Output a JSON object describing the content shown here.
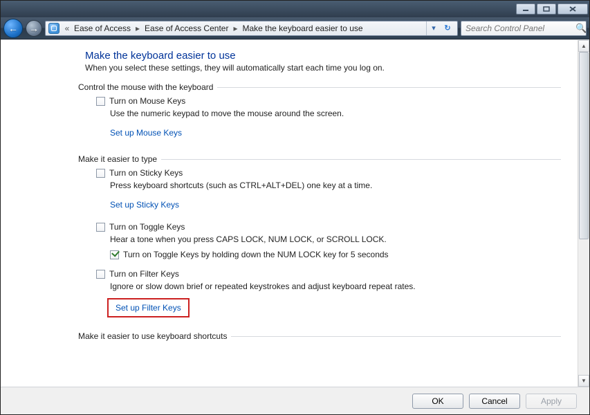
{
  "titlebar": {
    "min_tip": "Minimize",
    "max_tip": "Maximize",
    "close_tip": "Close"
  },
  "nav": {
    "back_tip": "Back",
    "fwd_tip": "Forward"
  },
  "breadcrumb": {
    "prefix": "«",
    "seg1": "Ease of Access",
    "seg2": "Ease of Access Center",
    "seg3": "Make the keyboard easier to use"
  },
  "search": {
    "placeholder": "Search Control Panel"
  },
  "page": {
    "title": "Make the keyboard easier to use",
    "subtitle": "When you select these settings, they will automatically start each time you log on."
  },
  "grp_mouse": {
    "head": "Control the mouse with the keyboard",
    "chk_label": "Turn on Mouse Keys",
    "desc": "Use the numeric keypad to move the mouse around the screen.",
    "link": "Set up Mouse Keys"
  },
  "grp_type": {
    "head": "Make it easier to type",
    "sticky_chk": "Turn on Sticky Keys",
    "sticky_desc": "Press keyboard shortcuts (such as CTRL+ALT+DEL) one key at a time.",
    "sticky_link": "Set up Sticky Keys",
    "toggle_chk": "Turn on Toggle Keys",
    "toggle_desc": "Hear a tone when you press CAPS LOCK, NUM LOCK, or SCROLL LOCK.",
    "toggle_sub_chk": "Turn on Toggle Keys by holding down the NUM LOCK key for 5 seconds",
    "filter_chk": "Turn on Filter Keys",
    "filter_desc": "Ignore or slow down brief or repeated keystrokes and adjust keyboard repeat rates.",
    "filter_link": "Set up Filter Keys"
  },
  "grp_shortcuts": {
    "head": "Make it easier to use keyboard shortcuts"
  },
  "buttons": {
    "ok": "OK",
    "cancel": "Cancel",
    "apply": "Apply"
  }
}
